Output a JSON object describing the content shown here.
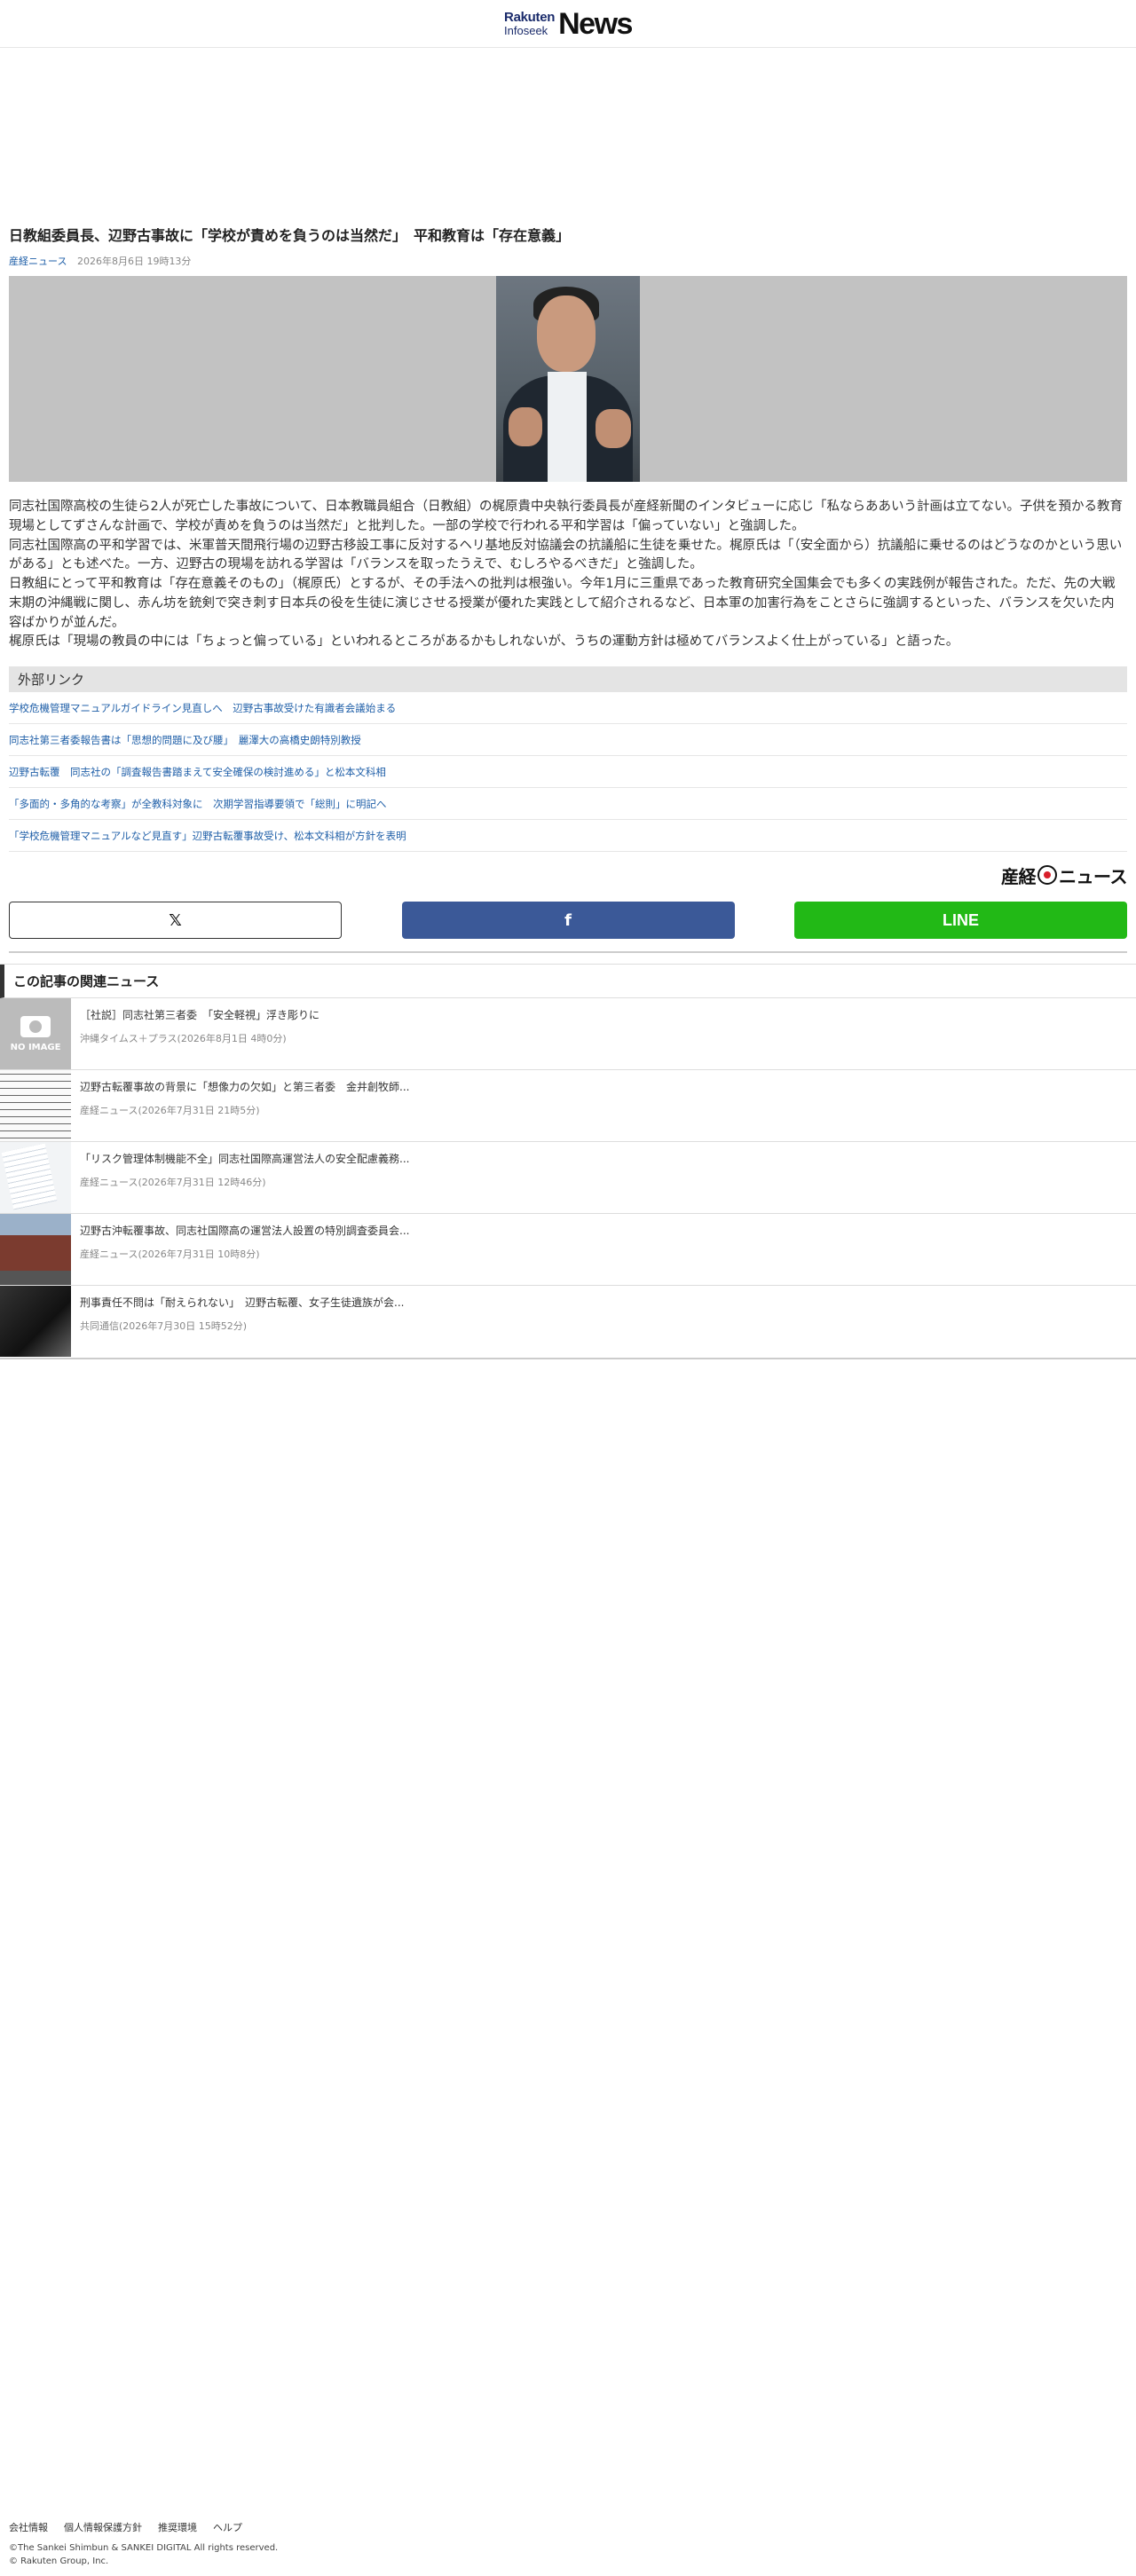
{
  "header": {
    "logo_top": "Rakuten",
    "logo_bottom": "Infoseek",
    "logo_main": "News"
  },
  "article": {
    "headline": "日教組委員長、辺野古事故に「学校が責めを負うのは当然だ」　平和教育は「存在意義」",
    "source": "産経ニュース",
    "date": "2026年8月6日 19時13分",
    "paragraphs": [
      "同志社国際高校の生徒ら2人が死亡した事故について、日本教職員組合（日教組）の梶原貴中央執行委員長が産経新聞のインタビューに応じ「私ならああいう計画は立てない。子供を預かる教育現場としてずさんな計画で、学校が責めを負うのは当然だ」と批判した。一部の学校で行われる平和学習は「偏っていない」と強調した。",
      "同志社国際高の平和学習では、米軍普天間飛行場の辺野古移設工事に反対するヘリ基地反対協議会の抗議船に生徒を乗せた。梶原氏は「（安全面から）抗議船に乗せるのはどうなのかという思いがある」とも述べた。一方、辺野古の現場を訪れる学習は「バランスを取ったうえで、むしろやるべきだ」と強調した。",
      "日教組にとって平和教育は「存在意義そのもの」（梶原氏）とするが、その手法への批判は根強い。今年1月に三重県であった教育研究全国集会でも多くの実践例が報告された。ただ、先の大戦末期の沖縄戦に関し、赤ん坊を銃剣で突き刺す日本兵の役を生徒に演じさせる授業が優れた実践として紹介されるなど、日本軍の加害行為をことさらに強調するといった、バランスを欠いた内容ばかりが並んだ。",
      "梶原氏は「現場の教員の中には「ちょっと偏っている」といわれるところがあるかもしれないが、うちの運動方針は極めてバランスよく仕上がっている」と語った。"
    ]
  },
  "external_links": {
    "title": "外部リンク",
    "items": [
      "学校危機管理マニュアルガイドライン見直しへ　辺野古事故受けた有識者会議始まる",
      "同志社第三者委報告書は「思想的問題に及び腰」　麗澤大の高橋史朗特別教授",
      "辺野古転覆　同志社の「調査報告書踏まえて安全確保の検討進める」と松本文科相",
      "「多面的・多角的な考察」が全教科対象に　次期学習指導要領で「総則」に明記へ",
      "「学校危機管理マニュアルなど見直す」辺野古転覆事故受け、松本文科相が方針を表明"
    ]
  },
  "brand": {
    "sankei_left": "産経",
    "sankei_right": "ニュース"
  },
  "share": {
    "x_label": "𝕏",
    "facebook_label": "f",
    "line_label": "LINE"
  },
  "related": {
    "title": "この記事の関連ニュース",
    "no_image_text": "NO IMAGE",
    "items": [
      {
        "title": "［社説］同志社第三者委　「安全軽視」浮き彫りに",
        "meta": "沖縄タイムス＋プラス(2026年8月1日 4時0分)"
      },
      {
        "title": "辺野古転覆事故の背景に「想像力の欠如」と第三者委　金井創牧師...",
        "meta": "産経ニュース(2026年7月31日 21時5分)"
      },
      {
        "title": "「リスク管理体制機能不全」同志社国際高運営法人の安全配慮義務...",
        "meta": "産経ニュース(2026年7月31日 12時46分)"
      },
      {
        "title": "辺野古沖転覆事故、同志社国際高の運営法人設置の特別調査委員会...",
        "meta": "産経ニュース(2026年7月31日 10時8分)"
      },
      {
        "title": "刑事責任不問は「耐えられない」　辺野古転覆、女子生徒遺族が会...",
        "meta": "共同通信(2026年7月30日 15時52分)"
      }
    ]
  },
  "footer": {
    "links": [
      "会社情報",
      "個人情報保護方針",
      "推奨環境",
      "ヘルプ"
    ],
    "copyright_1": "©The Sankei Shimbun & SANKEI DIGITAL All rights reserved.",
    "copyright_2": "© Rakuten Group, Inc."
  }
}
